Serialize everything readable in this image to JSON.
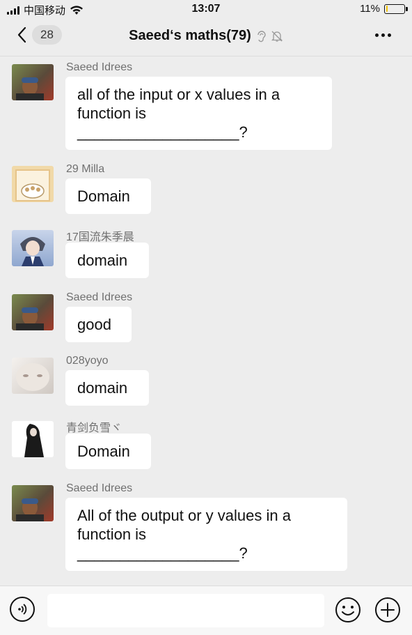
{
  "status_bar": {
    "carrier": "中国移动",
    "time": "13:07",
    "battery_percent": "11%",
    "battery_level": 0.11,
    "signal_icon": "signal-bars-icon",
    "wifi_icon": "wifi-icon"
  },
  "header": {
    "back_count": "28",
    "title": "Saeed‘s maths(79)",
    "icons": [
      "ear-icon",
      "mute-bell-icon"
    ],
    "more_icon": "more-dots-icon"
  },
  "messages": [
    {
      "sender": "Saeed Idrees",
      "text": "all of the input or x values in a\nfunction is\n___________________?",
      "avatar": "avatar-saeed"
    },
    {
      "sender": "29 Milla",
      "text": "Domain",
      "avatar": "avatar-milla"
    },
    {
      "sender": "17国流朱季晨",
      "text": "domain",
      "avatar": "avatar-anime"
    },
    {
      "sender": "Saeed Idrees",
      "text": "good",
      "avatar": "avatar-saeed"
    },
    {
      "sender": "028yoyo",
      "text": "domain",
      "avatar": "avatar-yoyo"
    },
    {
      "sender": "青剑负雪ヾ",
      "text": "Domain",
      "avatar": "avatar-qingjian"
    },
    {
      "sender": "Saeed Idrees",
      "text": "All of the output or y values in a\nfunction is\n___________________?",
      "avatar": "avatar-saeed"
    }
  ],
  "colors": {
    "background": "#ededed",
    "bubble": "#ffffff",
    "battery_fill": "#f2c200"
  },
  "input_bar": {
    "voice_icon": "voice-icon",
    "emoji_icon": "emoji-icon",
    "plus_icon": "plus-icon",
    "value": ""
  }
}
